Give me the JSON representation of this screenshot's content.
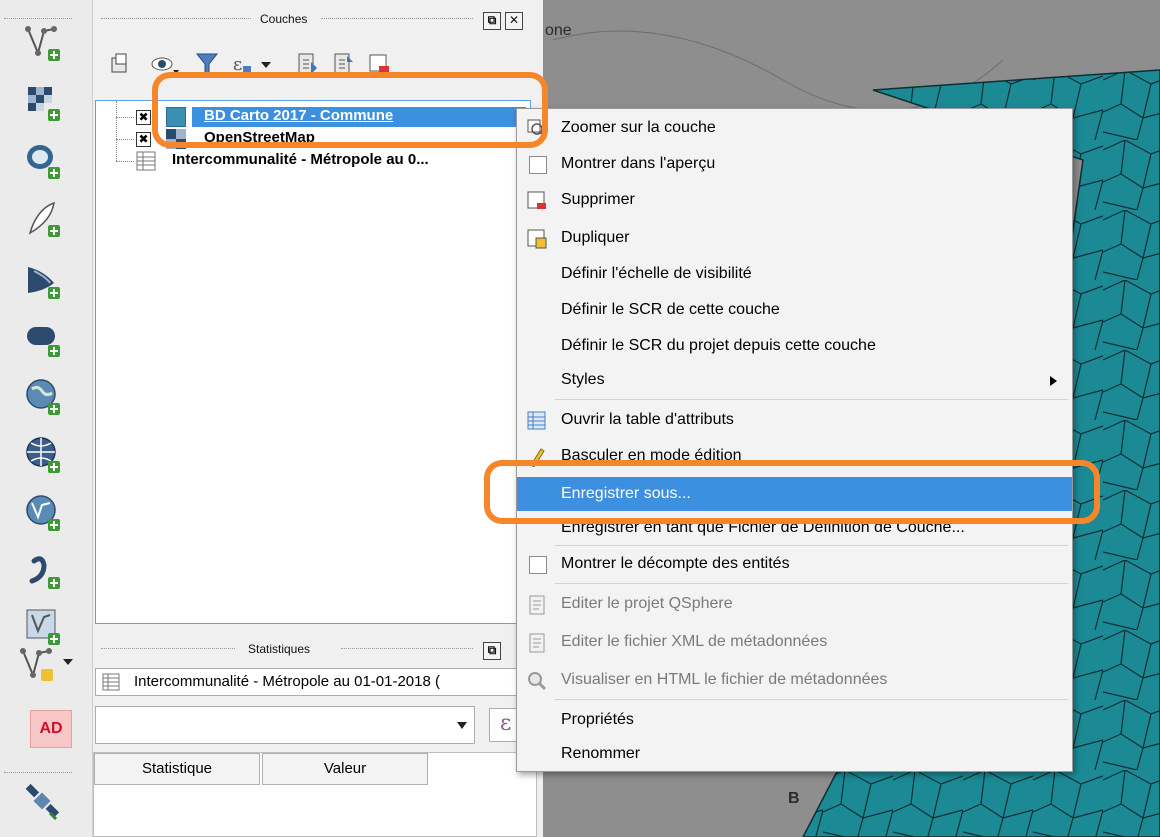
{
  "layers_panel": {
    "title": "Couches",
    "layers": [
      {
        "name": "BD Carto 2017 - Commune",
        "checked": true,
        "selected": true,
        "icon": "polygon-layer-icon",
        "color": "#3a8fb5"
      },
      {
        "name": "OpenStreetMap",
        "checked": true,
        "selected": false,
        "icon": "raster-layer-icon"
      },
      {
        "name": "Intercommunalité - Métropole au 0...",
        "checked": false,
        "selected": false,
        "icon": "table-layer-icon"
      }
    ]
  },
  "stats_panel": {
    "title": "Statistiques",
    "layer_select": "Intercommunalité - Métropole au 01-01-2018 (",
    "field_value": "",
    "columns": [
      "Statistique",
      "Valeur"
    ]
  },
  "map": {
    "label_top": "one",
    "label_bottom": "B"
  },
  "left_toolbar": {
    "ad_label": "AD"
  },
  "context_menu": {
    "items": [
      {
        "label": "Zoomer sur la couche",
        "icon": "zoom-layer-icon",
        "enabled": true
      },
      {
        "label": "Montrer dans l'aperçu",
        "icon": "checkbox-icon",
        "enabled": true
      },
      {
        "label": "Supprimer",
        "icon": "remove-layer-icon",
        "enabled": true
      },
      {
        "label": "Dupliquer",
        "icon": "duplicate-layer-icon",
        "enabled": true
      },
      {
        "label": "Définir l'échelle de visibilité",
        "icon": "",
        "enabled": true
      },
      {
        "label": "Définir le SCR de cette couche",
        "icon": "",
        "enabled": true
      },
      {
        "label": "Définir le SCR du projet depuis cette couche",
        "icon": "",
        "enabled": true
      },
      {
        "label": "Styles",
        "icon": "",
        "enabled": true,
        "submenu": true
      },
      {
        "label": "Ouvrir la table d'attributs",
        "icon": "attribute-table-icon",
        "enabled": true
      },
      {
        "label": "Basculer en mode édition",
        "icon": "pencil-icon",
        "enabled": true
      },
      {
        "label": "Enregistrer sous...",
        "icon": "",
        "enabled": true,
        "highlighted": true
      },
      {
        "label": "Enregistrer en tant que Fichier de Définition de Couche...",
        "icon": "",
        "enabled": true
      },
      {
        "label": "Montrer le décompte des entités",
        "icon": "checkbox-icon",
        "enabled": true
      },
      {
        "label": "Editer le projet QSphere",
        "icon": "document-icon",
        "enabled": false
      },
      {
        "label": "Editer le fichier XML de métadonnées",
        "icon": "document-icon",
        "enabled": false
      },
      {
        "label": "Visualiser en HTML le fichier de métadonnées",
        "icon": "magnifier-icon",
        "enabled": false
      },
      {
        "label": "Propriétés",
        "icon": "",
        "enabled": true
      },
      {
        "label": "Renommer",
        "icon": "",
        "enabled": true
      }
    ]
  },
  "colors": {
    "highlight": "#3d8fe0",
    "annotation": "#f5862a",
    "map_polygons": "#1b8a95",
    "map_background": "#8e8e8e"
  }
}
